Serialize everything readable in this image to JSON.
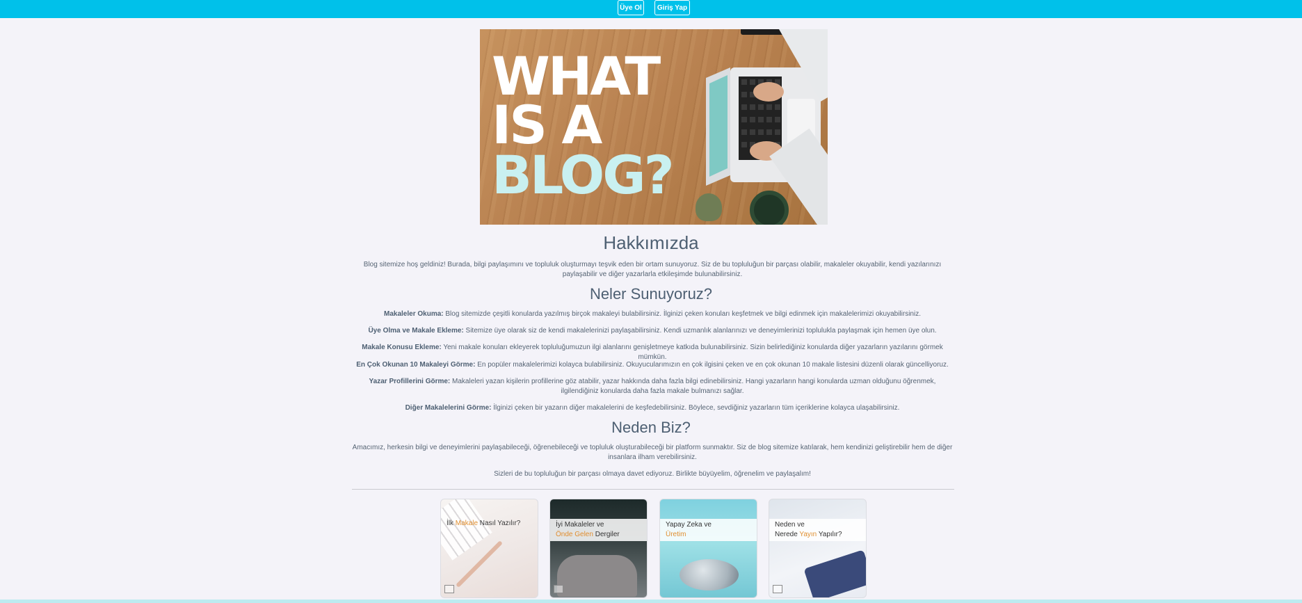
{
  "header": {
    "register_label": "Üye Ol",
    "login_label": "Giriş Yap"
  },
  "hero": {
    "line1": "WHAT",
    "line2": "IS A",
    "line3": "BLOG?"
  },
  "about": {
    "title": "Hakkımızda",
    "text": "Blog sitemize hoş geldiniz! Burada, bilgi paylaşımını ve topluluk oluşturmayı teşvik eden bir ortam sunuyoruz. Siz de bu topluluğun bir parçası olabilir, makaleler okuyabilir, kendi yazılarınızı paylaşabilir ve diğer yazarlarla etkileşimde bulunabilirsiniz."
  },
  "offer": {
    "title": "Neler Sunuyoruz?",
    "items": [
      {
        "label": "Makaleler Okuma:",
        "text": " Blog sitemizde çeşitli konularda yazılmış birçok makaleyi bulabilirsiniz. İlginizi çeken konuları keşfetmek ve bilgi edinmek için makalelerimizi okuyabilirsiniz."
      },
      {
        "label": "Üye Olma ve Makale Ekleme:",
        "text": " Sitemize üye olarak siz de kendi makalelerinizi paylaşabilirsiniz. Kendi uzmanlık alanlarınızı ve deneyimlerinizi toplulukla paylaşmak için hemen üye olun."
      },
      {
        "label": "Makale Konusu Ekleme:",
        "text": " Yeni makale konuları ekleyerek topluluğumuzun ilgi alanlarını genişletmeye katkıda bulunabilirsiniz. Sizin belirlediğiniz konularda diğer yazarların yazılarını görmek mümkün."
      },
      {
        "label": "En Çok Okunan 10 Makaleyi Görme:",
        "text": " En popüler makalelerimizi kolayca bulabilirsiniz. Okuyucularımızın en çok ilgisini çeken ve en çok okunan 10 makale listesini düzenli olarak güncelliyoruz."
      },
      {
        "label": "Yazar Profillerini Görme:",
        "text": " Makaleleri yazan kişilerin profillerine göz atabilir, yazar hakkında daha fazla bilgi edinebilirsiniz. Hangi yazarların hangi konularda uzman olduğunu öğrenmek, ilgilendiğiniz konularda daha fazla makale bulmanızı sağlar."
      },
      {
        "label": "Diğer Makalelerini Görme:",
        "text": " İlginizi çeken bir yazarın diğer makalelerini de keşfedebilirsiniz. Böylece, sevdiğiniz yazarların tüm içeriklerine kolayca ulaşabilirsiniz."
      }
    ]
  },
  "why": {
    "title": "Neden Biz?",
    "text1": "Amacımız, herkesin bilgi ve deneyimlerini paylaşabileceği, öğrenebileceği ve topluluk oluşturabileceği bir platform sunmaktır. Siz de blog sitemize katılarak, hem kendinizi geliştirebilir hem de diğer insanlara ilham verebilirsiniz.",
    "text2": "Sizleri de bu topluluğun bir parçası olmaya davet ediyoruz. Birlikte büyüyelim, öğrenelim ve paylaşalım!"
  },
  "cards": [
    {
      "pre": "İlk ",
      "hl": "Makale",
      "post": " Nasıl Yazılır?"
    },
    {
      "line1": "İyi Makaleler ve",
      "hl": "Önde Gelen",
      "post": " Dergiler"
    },
    {
      "line1": "Yapay Zeka ve",
      "hl": "Üretim"
    },
    {
      "line1": "Neden ve",
      "pre2": "Nerede ",
      "hl": "Yayın",
      "post": " Yapılır?"
    }
  ],
  "colors": {
    "header_bg": "#00c1ea",
    "page_bg": "#f4f3f9",
    "heading": "#4d5f72",
    "highlight": "#e08e2f"
  }
}
